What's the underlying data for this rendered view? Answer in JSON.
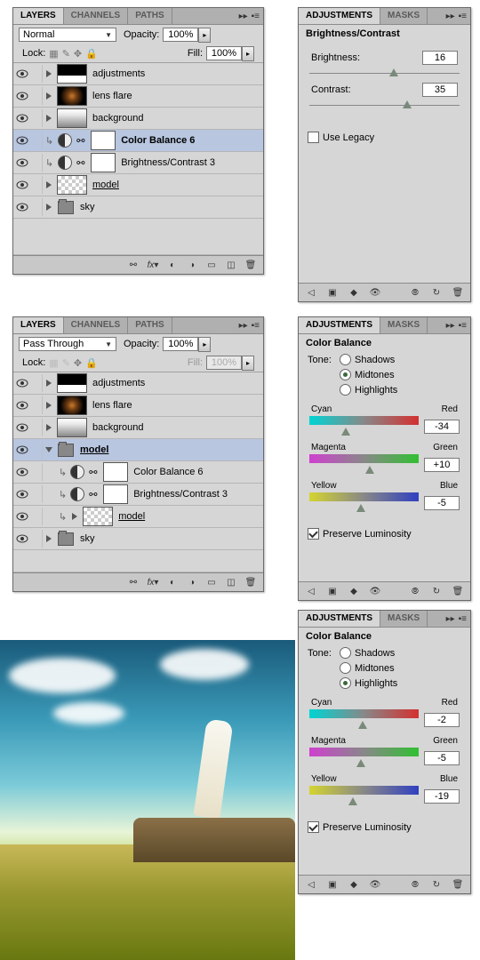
{
  "layers1": {
    "tabs": [
      "LAYERS",
      "CHANNELS",
      "PATHS"
    ],
    "blend": "Normal",
    "opacity_label": "Opacity:",
    "opacity": "100%",
    "lock_label": "Lock:",
    "fill_label": "Fill:",
    "fill": "100%",
    "items": [
      {
        "name": "adjustments",
        "type": "histo"
      },
      {
        "name": "lens flare",
        "type": "flare"
      },
      {
        "name": "background",
        "type": "grad"
      },
      {
        "name": "Color Balance 6",
        "type": "adj",
        "sel": true,
        "bold": true
      },
      {
        "name": "Brightness/Contrast 3",
        "type": "adj"
      },
      {
        "name": "model",
        "type": "checker",
        "u": true
      },
      {
        "name": "sky",
        "type": "folder"
      }
    ]
  },
  "layers2": {
    "tabs": [
      "LAYERS",
      "CHANNELS",
      "PATHS"
    ],
    "blend": "Pass Through",
    "opacity_label": "Opacity:",
    "opacity": "100%",
    "lock_label": "Lock:",
    "fill_label": "Fill:",
    "fill": "100%",
    "items": [
      {
        "name": "adjustments",
        "type": "histo"
      },
      {
        "name": "lens flare",
        "type": "flare"
      },
      {
        "name": "background",
        "type": "grad"
      },
      {
        "name": "model",
        "type": "folder",
        "sel": true,
        "bold": true,
        "open": true,
        "u": true
      },
      {
        "name": "Color Balance 6",
        "type": "adj",
        "indent": true
      },
      {
        "name": "Brightness/Contrast 3",
        "type": "adj",
        "indent": true
      },
      {
        "name": "model",
        "type": "checker",
        "u": true,
        "indent": true
      },
      {
        "name": "sky",
        "type": "folder"
      }
    ]
  },
  "adj1": {
    "tabs": [
      "ADJUSTMENTS",
      "MASKS"
    ],
    "title": "Brightness/Contrast",
    "brightness_label": "Brightness:",
    "brightness": "16",
    "contrast_label": "Contrast:",
    "contrast": "35",
    "legacy": "Use Legacy"
  },
  "adj2": {
    "tabs": [
      "ADJUSTMENTS",
      "MASKS"
    ],
    "title": "Color Balance",
    "tone_label": "Tone:",
    "tones": [
      "Shadows",
      "Midtones",
      "Highlights"
    ],
    "tone_sel": 1,
    "cyan": "Cyan",
    "red": "Red",
    "magenta": "Magenta",
    "green": "Green",
    "yellow": "Yellow",
    "blue": "Blue",
    "v1": "-34",
    "v2": "+10",
    "v3": "-5",
    "preserve": "Preserve Luminosity"
  },
  "adj3": {
    "tabs": [
      "ADJUSTMENTS",
      "MASKS"
    ],
    "title": "Color Balance",
    "tone_label": "Tone:",
    "tones": [
      "Shadows",
      "Midtones",
      "Highlights"
    ],
    "tone_sel": 2,
    "cyan": "Cyan",
    "red": "Red",
    "magenta": "Magenta",
    "green": "Green",
    "yellow": "Yellow",
    "blue": "Blue",
    "v1": "-2",
    "v2": "-5",
    "v3": "-19",
    "preserve": "Preserve Luminosity"
  }
}
